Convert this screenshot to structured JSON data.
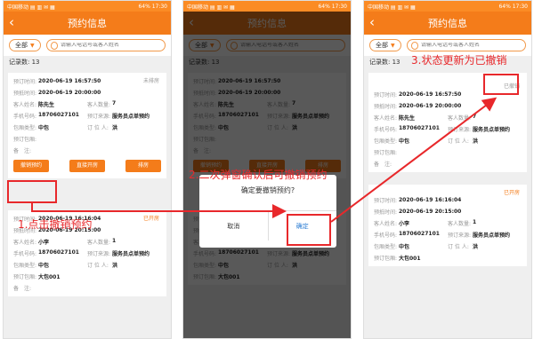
{
  "status_left": "中国移动 ▤ ▥ ✉ ▦",
  "status_right": "64% 17:30",
  "page_title": "预约信息",
  "filter_label": "全部",
  "search_placeholder": "请输入电话号或客人姓名",
  "records_label": "记录数:",
  "records_count": "13",
  "labels": {
    "book_time": "预订时间:",
    "arrive_time": "预抵时间:",
    "guest_name": "客人姓名:",
    "guest_count": "客人数量:",
    "phone": "手机号码:",
    "source": "预订来源:",
    "room_type": "包厢类型:",
    "booker": "订 位 人:",
    "room": "预订包厢:",
    "remark": "备　注:"
  },
  "record1": {
    "status_before": "未排房",
    "status_after": "已撤销",
    "book_time": "2020-06-19 16:57:50",
    "arrive_time": "2020-06-19 20:00:00",
    "guest_name": "陈先生",
    "guest_count": "7",
    "phone": "18706027101",
    "source": "服务员点单预约",
    "room_type": "中包",
    "booker": "洪",
    "room": "",
    "remark": ""
  },
  "record2": {
    "status": "已开房",
    "book_time": "2020-06-19 16:16:04",
    "arrive_time": "2020-06-19 20:15:00",
    "guest_name": "小李",
    "guest_count": "1",
    "phone": "18706027101",
    "source": "服务员点单预约",
    "room_type": "中包",
    "booker": "洪",
    "room": "大包001",
    "remark": ""
  },
  "buttons": {
    "cancel_booking": "撤销预约",
    "direct_open": "直接开房",
    "assign_room": "排房"
  },
  "dialog": {
    "message": "确定要撤销预约?",
    "cancel": "取消",
    "confirm": "确定"
  },
  "annotations": {
    "step1": "1.点击撤销预约",
    "step2": "2.二次弹窗确认后可撤销预约",
    "step3": "3.状态更新为已撤销"
  },
  "colors": {
    "brand": "#f47c1a",
    "annotation": "#e8282b",
    "confirm": "#2b7cd3"
  }
}
